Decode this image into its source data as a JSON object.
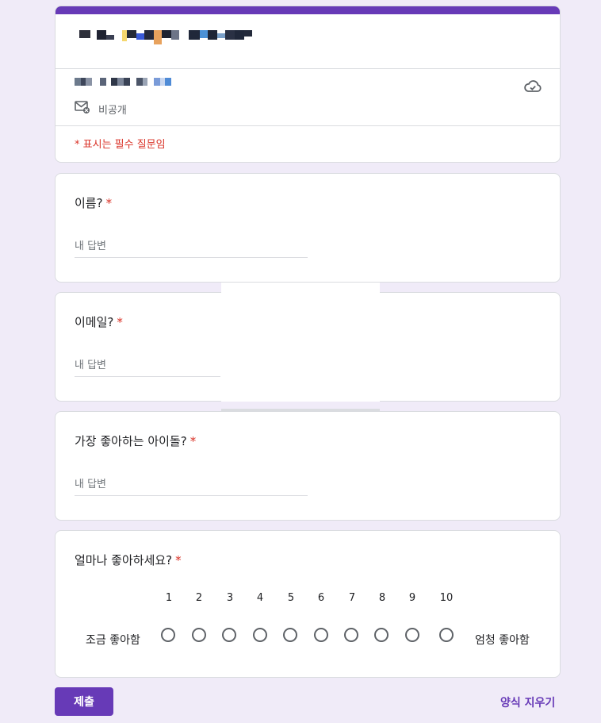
{
  "form": {
    "private_label": "비공개",
    "required_note": "* 표시는 필수 질문임",
    "star": "*"
  },
  "questions": [
    {
      "title": "이름?",
      "placeholder": "내 답변"
    },
    {
      "title": "이메일?",
      "placeholder": "내 답변"
    },
    {
      "title": "가장 좋아하는 아이돌?",
      "placeholder": "내 답변"
    },
    {
      "title": "얼마나 좋아하세요?"
    }
  ],
  "scale": {
    "numbers": [
      "1",
      "2",
      "3",
      "4",
      "5",
      "6",
      "7",
      "8",
      "9",
      "10"
    ],
    "min_label": "조금 좋아함",
    "max_label": "엄청 좋아함"
  },
  "actions": {
    "submit_label": "제출",
    "clear_label": "양식 지우기"
  },
  "colors": {
    "accent": "#673ab7",
    "background": "#f0ebf8",
    "required": "#d93025"
  },
  "icons": [
    "envelope-icon",
    "cloud-icon"
  ]
}
